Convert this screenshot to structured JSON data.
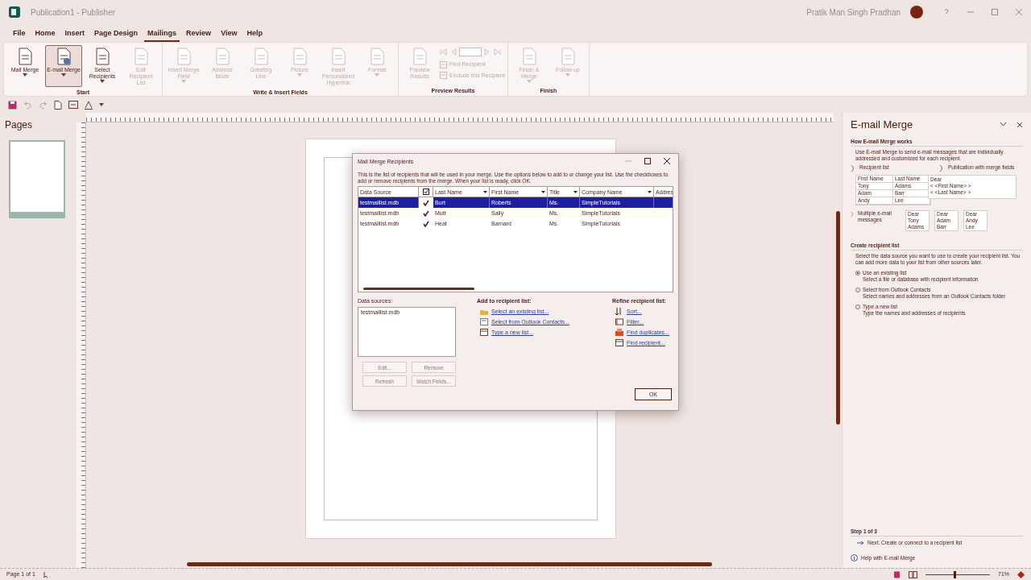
{
  "window": {
    "title": "Publication1 - Publisher",
    "user": "Pratik Man Singh Pradhan"
  },
  "menu_tabs": [
    {
      "label": "File",
      "selected": false
    },
    {
      "label": "Home",
      "selected": false
    },
    {
      "label": "Insert",
      "selected": false
    },
    {
      "label": "Page Design",
      "selected": false
    },
    {
      "label": "Mailings",
      "selected": true
    },
    {
      "label": "Review",
      "selected": false
    },
    {
      "label": "View",
      "selected": false
    },
    {
      "label": "Help",
      "selected": false
    }
  ],
  "ribbon_groups": [
    {
      "label": "Start",
      "buttons": [
        {
          "kind": "large",
          "label": "Mail Merge",
          "dropdown": true,
          "disabled": false,
          "selected": false
        },
        {
          "kind": "large",
          "label": "E-mail Merge",
          "dropdown": true,
          "disabled": false,
          "selected": true
        },
        {
          "kind": "large",
          "label": "Select Recipients",
          "dropdown": true,
          "disabled": false,
          "selected": false
        },
        {
          "kind": "large",
          "label": "Edit Recipient List",
          "dropdown": false,
          "disabled": true,
          "selected": false
        }
      ]
    },
    {
      "label": "Write & Insert Fields",
      "buttons": [
        {
          "kind": "large",
          "label": "Insert Merge Field",
          "dropdown": true,
          "disabled": true,
          "selected": false
        },
        {
          "kind": "large",
          "label": "Address Block",
          "dropdown": false,
          "disabled": true,
          "selected": false
        },
        {
          "kind": "large",
          "label": "Greeting Line",
          "dropdown": false,
          "disabled": true,
          "selected": false
        },
        {
          "kind": "large",
          "label": "Picture",
          "dropdown": true,
          "disabled": true,
          "selected": false
        },
        {
          "kind": "large",
          "label": "Insert Personalized Hyperlink",
          "dropdown": false,
          "disabled": true,
          "selected": false
        },
        {
          "kind": "large",
          "label": "Format",
          "dropdown": true,
          "disabled": true,
          "selected": false
        }
      ]
    },
    {
      "label": "Preview Results",
      "buttons": [
        {
          "kind": "large",
          "label": "Preview Results",
          "dropdown": false,
          "disabled": true,
          "selected": false
        },
        {
          "kind": "nav",
          "disabled": true
        },
        {
          "kind": "small",
          "label": "Find Recipient",
          "disabled": true
        },
        {
          "kind": "small",
          "label": "Exclude this Recipient",
          "disabled": true
        }
      ]
    },
    {
      "label": "Finish",
      "buttons": [
        {
          "kind": "large",
          "label": "Finish & Merge",
          "dropdown": true,
          "disabled": true,
          "selected": false
        },
        {
          "kind": "large",
          "label": "Follow up",
          "dropdown": true,
          "disabled": true,
          "selected": false
        }
      ]
    }
  ],
  "pages_pane": {
    "title": "Pages"
  },
  "dialog": {
    "title": "Mail Merge Recipients",
    "instructions": "This is the list of recipients that will be used in your merge. Use the options below to add to or change your list. Use the checkboxes to add or remove recipients from the merge. When your list is ready, click OK.",
    "columns": [
      "Data Source",
      "Last Name",
      "First Name",
      "Title",
      "Company Name",
      "Addres"
    ],
    "rows": [
      {
        "selected": true,
        "checked": true,
        "cells": [
          "testmaillist.mdb",
          "Burt",
          "Roberts",
          "Ms.",
          "SimpleTutorials",
          ""
        ]
      },
      {
        "selected": false,
        "checked": true,
        "cells": [
          "testmaillist.mdb",
          "Mutt",
          "Sally",
          "Ms.",
          "SimpleTutorials",
          ""
        ]
      },
      {
        "selected": false,
        "checked": true,
        "cells": [
          "testmaillist.mdb",
          "Heat",
          "Barnard",
          "Ms.",
          "SimpleTutorials",
          ""
        ]
      }
    ],
    "data_sources_label": "Data sources:",
    "data_sources": [
      "testmaillist.mdb"
    ],
    "source_buttons": [
      "Edit...",
      "Remove",
      "Refresh",
      "Match Fields..."
    ],
    "add_label": "Add to recipient list:",
    "add_links": [
      "Select an existing list...",
      "Select from Outlook Contacts...",
      "Type a new list..."
    ],
    "refine_label": "Refine recipient list:",
    "refine_links": [
      "Sort...",
      "Filter...",
      "Find duplicates...",
      "Find recipient..."
    ],
    "ok": "OK"
  },
  "task_pane": {
    "title": "E-mail Merge",
    "how_heading": "How E-mail Merge works",
    "how_text": "Use E-mail Merge to send e-mail messages that are individually addressed and customized for each recipient.",
    "recipient_label": "Recipient list",
    "publication_label": "Publication with merge fields",
    "list_headers": [
      "First Name",
      "Last Name"
    ],
    "list_rows": [
      [
        "Tony",
        "Adams"
      ],
      [
        "Adam",
        "Barr"
      ],
      [
        "Andy",
        "Lee"
      ]
    ],
    "letter": [
      "Dear",
      "< <First Name> >",
      "< <Last Name> >"
    ],
    "multiple_label": "Multiple e-mail messages",
    "messages": [
      [
        "Dear",
        "Tony",
        "Adams"
      ],
      [
        "Dear",
        "Adam",
        "Barr"
      ],
      [
        "Dear",
        "Andy",
        "Lee"
      ]
    ],
    "create_heading": "Create recipient list",
    "create_text": "Select the data source you want to use to create your recipient list. You can add more data to your list from other sources later.",
    "options": [
      {
        "label": "Use an existing list",
        "description": "Select a file or database with recipient information",
        "selected": true
      },
      {
        "label": "Select from Outlook Contacts",
        "description": "Select names and addresses from an Outlook Contacts folder",
        "selected": false
      },
      {
        "label": "Type a new list",
        "description": "Type the names and addresses of recipients",
        "selected": false
      }
    ],
    "step": "Step 1 of 3",
    "next": "Next: Create or connect to a recipient list",
    "help": "Help with E-mail Merge"
  },
  "status_bar": {
    "page": "Page 1 of 1",
    "zoom": "71%",
    "zoom_level": {
      "level": 0.45
    }
  }
}
